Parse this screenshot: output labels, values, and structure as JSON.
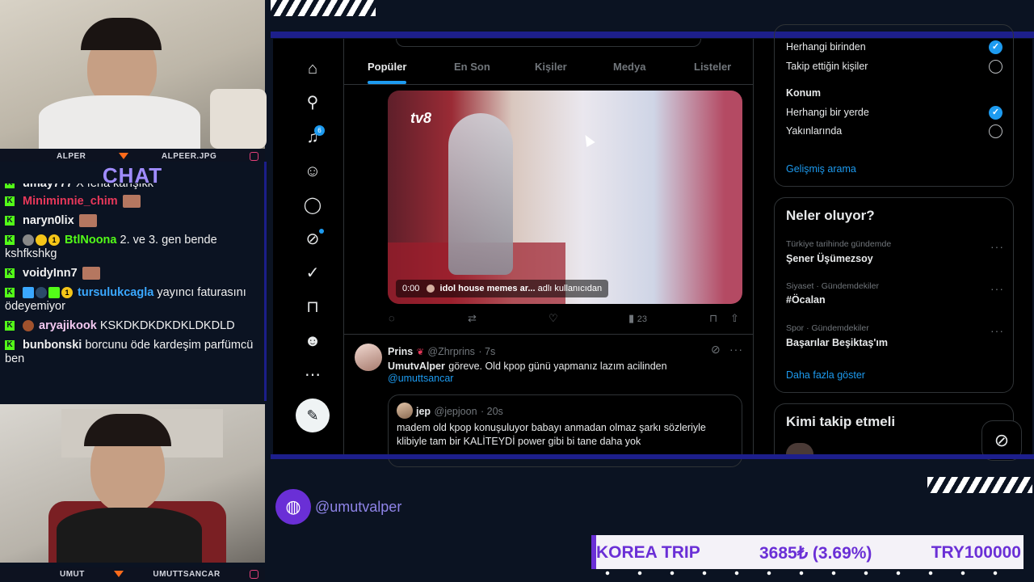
{
  "streamer_cam_top": {
    "left_label": "ALPER",
    "right_label": "ALPEER.JPG"
  },
  "streamer_cam_bottom": {
    "left_label": "UMUT",
    "right_label": "UMUTTSANCAR"
  },
  "chat": {
    "title": "CHAT",
    "messages": [
      {
        "user": "umay777",
        "text": "X fena karışıkk",
        "color": "#e7e9ea"
      },
      {
        "user": "Miniminnie_chim",
        "text": "",
        "color": "#e8385a"
      },
      {
        "user": "naryn0lix",
        "text": "",
        "color": "#e7e9ea"
      },
      {
        "user": "BtlNoona",
        "text": "2. ve 3. gen bende kshfkshkg",
        "color": "#53fc18"
      },
      {
        "user": "voidyInn7",
        "text": "",
        "color": "#e7e9ea"
      },
      {
        "user": "tursulukcagla",
        "text": "yayıncı faturasını ödeyemiyor",
        "color": "#3aa8ff"
      },
      {
        "user": "aryajikook",
        "text": "KSKDKDKDKDKLDKDLD",
        "color": "#f3c8f0"
      },
      {
        "user": "bunbonski",
        "text": "borcunu öde kardeşim parfümcü ben",
        "color": "#e7e9ea"
      }
    ]
  },
  "nav": {
    "notification_count": "6",
    "icons": [
      "home-icon",
      "search-icon",
      "bell-icon",
      "add-person-icon",
      "message-icon",
      "grok-icon",
      "verified-icon",
      "bookmark-icon",
      "profile-icon",
      "more-icon",
      "compose-icon"
    ]
  },
  "tabs": [
    "Popüler",
    "En Son",
    "Kişiler",
    "Medya",
    "Listeler"
  ],
  "media_post": {
    "time": "0:00",
    "attribution_user": "idol house memes ar...",
    "attribution_suffix": "adlı kullanıcıdan",
    "logo_text": "tv8",
    "views": "23"
  },
  "reply_post": {
    "name": "Prins",
    "handle": "@Zhrprins",
    "time": "· 7s",
    "mention_name": "UmutvAlper",
    "text": "göreve. Old kpop günü yapmanız lazım acilinden",
    "link": "@umuttsancar",
    "quote": {
      "name": "jep",
      "handle": "@jepjoon",
      "time": "· 20s",
      "text_line1": "madem old kpop konuşuluyor babayı anmadan olmaz şarkı sözleriyle",
      "text_line2": "klibiyle tam bir KALİTEYDİ power gibi bi tane daha yok"
    }
  },
  "search_filters": {
    "people_options": [
      {
        "label": "Herhangi birinden",
        "selected": true
      },
      {
        "label": "Takip ettiğin kişiler",
        "selected": false
      }
    ],
    "location_title": "Konum",
    "location_options": [
      {
        "label": "Herhangi bir yerde",
        "selected": true
      },
      {
        "label": "Yakınlarında",
        "selected": false
      }
    ],
    "advanced_link": "Gelişmiş arama"
  },
  "trends": {
    "title": "Neler oluyor?",
    "items": [
      {
        "context": "Türkiye tarihinde gündemde",
        "name": "Şener Üşümezsoy"
      },
      {
        "context": "Siyaset · Gündemdekiler",
        "name": "#Öcalan"
      },
      {
        "context": "Spor · Gündemdekiler",
        "name": "Başarılar Beşiktaş'ım"
      }
    ],
    "show_more": "Daha fazla göster"
  },
  "who_to_follow": {
    "title": "Kimi takip etmeli"
  },
  "overlay": {
    "social_handle": "@umutvalper",
    "ticker": {
      "label": "KOREA TRIP",
      "progress": "3685₺ (3.69%)",
      "goal": "TRY100000"
    },
    "accent_color": "#6a2fd6",
    "frame_color": "#1d1f8c"
  }
}
